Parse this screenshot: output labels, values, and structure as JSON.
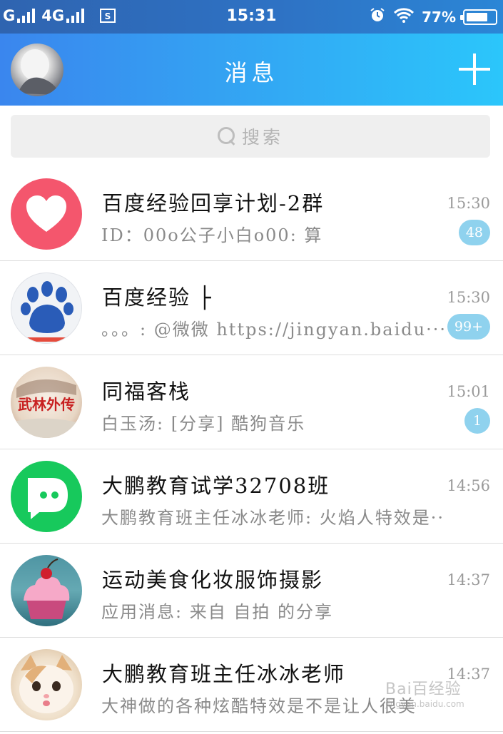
{
  "status_bar": {
    "carrier1": "G",
    "network": "4G",
    "time": "15:31",
    "battery_text": "77%",
    "battery_level": 0.77
  },
  "header": {
    "title": "消息"
  },
  "search": {
    "placeholder": "搜索"
  },
  "conversations": [
    {
      "name": "百度经验回享计划-2群",
      "preview": "ID：00o公子小白o00: 算",
      "time": "15:30",
      "badge": "48"
    },
    {
      "name": "百度经验 ├",
      "preview": "。。。: @微微 https://jingyan.baidu···",
      "time": "15:30",
      "badge": "99+"
    },
    {
      "name": "同福客栈",
      "preview": "白玉汤: [分享] 酷狗音乐",
      "time": "15:01",
      "badge": "1"
    },
    {
      "name": "大鹏教育试学32708班",
      "preview": "大鹏教育班主任冰冰老师: 火焰人特效是···",
      "time": "14:56",
      "badge": ""
    },
    {
      "name": "运动美食化妆服饰摄影",
      "preview": "应用消息: 来自 自拍 的分享",
      "time": "14:37",
      "badge": ""
    },
    {
      "name": "大鹏教育班主任冰冰老师",
      "preview": "大神做的各种炫酷特效是不是让人很美",
      "time": "14:37",
      "badge": ""
    }
  ],
  "avatar_texts": {
    "baidu": "du",
    "wulin": "武林外传"
  },
  "watermark": {
    "text": "Bai百经验",
    "url": "jingyan.baidu.com"
  },
  "colors": {
    "header_start": "#3a86ee",
    "header_end": "#2bc6fb",
    "badge": "#8fd2ee",
    "heart_bg": "#f4566d",
    "dapeng_bg": "#17c95c"
  }
}
